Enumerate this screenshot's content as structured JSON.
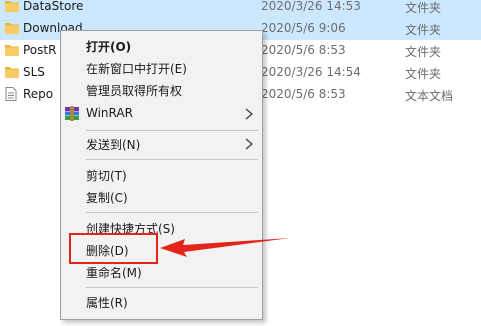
{
  "files": [
    {
      "name": "DataStore",
      "date": "2020/3/26 14:53",
      "type": "文件夹",
      "icon": "folder-icon",
      "selected": true
    },
    {
      "name": "Download",
      "date": "2020/5/6 9:06",
      "type": "文件夹",
      "icon": "folder-icon",
      "selected": true
    },
    {
      "name": "PostR",
      "date": "2020/5/6 8:53",
      "type": "文件夹",
      "icon": "folder-icon",
      "selected": false
    },
    {
      "name": "SLS",
      "date": "2020/3/26 14:54",
      "type": "文件夹",
      "icon": "folder-icon",
      "selected": false
    },
    {
      "name": "Repo",
      "date": "2020/5/6 8:53",
      "type": "文本文档",
      "icon": "text-file-icon",
      "selected": false
    }
  ],
  "context_menu": {
    "open": "打开(O)",
    "open_new_window": "在新窗口中打开(E)",
    "take_ownership": "管理员取得所有权",
    "winrar": "WinRAR",
    "send_to": "发送到(N)",
    "cut": "剪切(T)",
    "copy": "复制(C)",
    "create_shortcut": "创建快捷方式(S)",
    "delete": "删除(D)",
    "rename": "重命名(M)",
    "properties": "属性(R)"
  },
  "colors": {
    "selection": "#cce8ff",
    "menu_background": "#f2f2f2",
    "annotation": "#e3241b",
    "folder": "#f4c35a"
  }
}
